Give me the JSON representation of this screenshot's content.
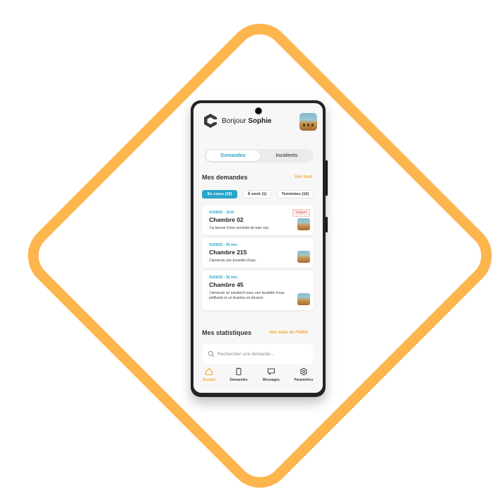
{
  "colors": {
    "accent": "#f3a530",
    "primary": "#2aa6c9",
    "urgent": "#d9534f"
  },
  "header": {
    "greeting": "Bonjour",
    "name": "Sophie"
  },
  "tabs": [
    {
      "label": "Demandes",
      "selected": true
    },
    {
      "label": "Incidents",
      "selected": false
    }
  ],
  "requests": {
    "title": "Mes demandes",
    "see_all": "Voir tout",
    "filters": [
      {
        "label": "En cours (10)",
        "active": true
      },
      {
        "label": "À venir (1)",
        "active": false
      },
      {
        "label": "Terminées (10)",
        "active": false
      }
    ],
    "items": [
      {
        "date": "01/09/22 - 1h10",
        "room": "Chambre 02",
        "message": "J'ai besoin d'une serviette de bain svp.",
        "badge": "Urgent"
      },
      {
        "date": "01/09/22 - 35 min",
        "room": "Chambre 215",
        "message": "J'aimerais une bouteille d'eau."
      },
      {
        "date": "01/09/22 - 35 min",
        "room": "Chambre 45",
        "message": "J'aimerais un sandwich avec une bouteille d'eau pétillante et un tiramisu en dessert."
      }
    ]
  },
  "stats": {
    "title": "Mes statistiques",
    "link": "Voir stats de l'hôtel"
  },
  "search": {
    "placeholder": "Rechercher une demande..."
  },
  "nav": [
    {
      "label": "Accueil",
      "icon": "home-icon",
      "selected": true
    },
    {
      "label": "Demandes",
      "icon": "document-icon",
      "selected": false
    },
    {
      "label": "Messages",
      "icon": "chat-icon",
      "selected": false
    },
    {
      "label": "Paramètres",
      "icon": "settings-icon",
      "selected": false
    }
  ]
}
